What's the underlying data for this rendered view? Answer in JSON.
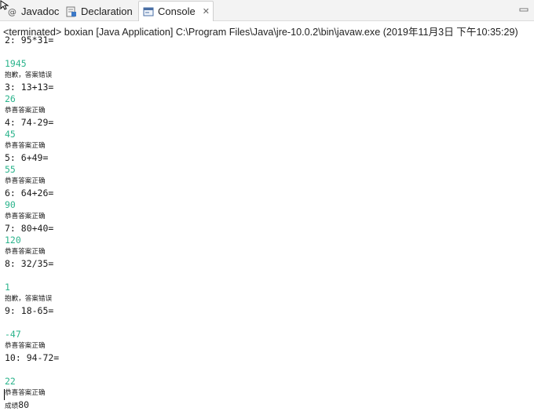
{
  "tabs": [
    {
      "label": "Javadoc",
      "icon": "javadoc-icon"
    },
    {
      "label": "Declaration",
      "icon": "declaration-icon"
    },
    {
      "label": "Console",
      "icon": "console-icon",
      "active": true
    }
  ],
  "status": "<terminated> boxian [Java Application] C:\\Program Files\\Java\\jre-10.0.2\\bin\\javaw.exe (2019年11月3日 下午10:35:29)",
  "console": {
    "lines": [
      {
        "type": "q",
        "text": "2: 95*31="
      },
      {
        "type": "blank",
        "text": ""
      },
      {
        "type": "in",
        "text": "1945"
      },
      {
        "type": "msg",
        "text": "抱歉，答案错误"
      },
      {
        "type": "q",
        "text": "3: 13+13="
      },
      {
        "type": "in",
        "text": "26"
      },
      {
        "type": "msg",
        "text": "恭喜答案正确"
      },
      {
        "type": "q",
        "text": "4: 74-29="
      },
      {
        "type": "in",
        "text": "45"
      },
      {
        "type": "msg",
        "text": "恭喜答案正确"
      },
      {
        "type": "q",
        "text": "5: 6+49="
      },
      {
        "type": "in",
        "text": "55"
      },
      {
        "type": "msg",
        "text": "恭喜答案正确"
      },
      {
        "type": "q",
        "text": "6: 64+26="
      },
      {
        "type": "in",
        "text": "90"
      },
      {
        "type": "msg",
        "text": "恭喜答案正确"
      },
      {
        "type": "q",
        "text": "7: 80+40="
      },
      {
        "type": "in",
        "text": "120"
      },
      {
        "type": "msg",
        "text": "恭喜答案正确"
      },
      {
        "type": "q",
        "text": "8: 32/35="
      },
      {
        "type": "blank",
        "text": ""
      },
      {
        "type": "in",
        "text": "1"
      },
      {
        "type": "msg",
        "text": "抱歉，答案错误"
      },
      {
        "type": "q",
        "text": "9: 18-65="
      },
      {
        "type": "blank",
        "text": ""
      },
      {
        "type": "in",
        "text": "-47"
      },
      {
        "type": "msg",
        "text": "恭喜答案正确"
      },
      {
        "type": "q",
        "text": "10: 94-72="
      },
      {
        "type": "blank",
        "text": ""
      },
      {
        "type": "in",
        "text": "22"
      },
      {
        "type": "msg",
        "text": "恭喜答案正确"
      }
    ],
    "score_label": "成绩",
    "score_value": "80"
  },
  "colors": {
    "input": "#2ab38b",
    "text": "#1a1a1a"
  }
}
